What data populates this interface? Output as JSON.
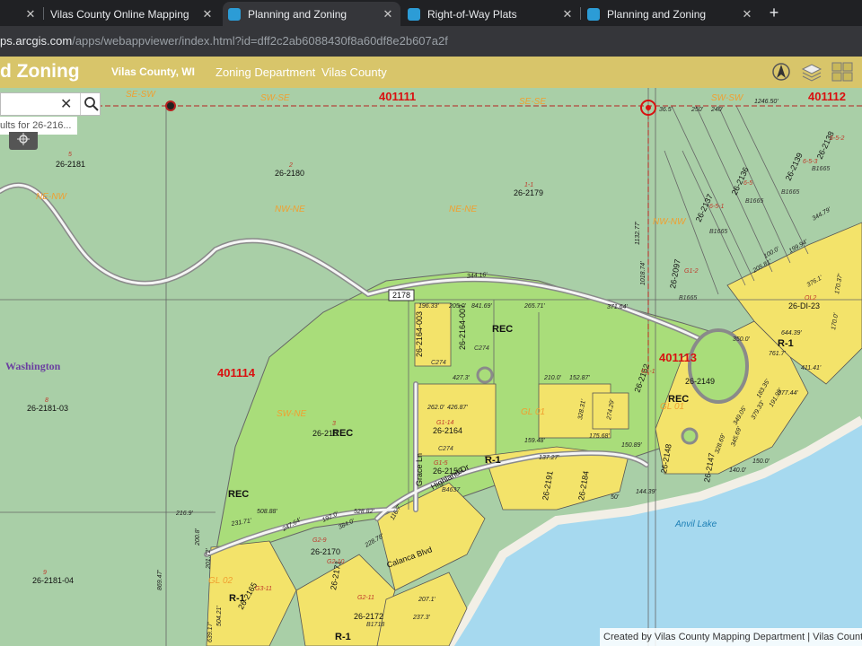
{
  "browser": {
    "tabs": [
      {
        "title": "Vilas County Online Mapping",
        "favicon": "map-icon"
      },
      {
        "title": "Planning and Zoning",
        "favicon": "esri-icon"
      },
      {
        "title": "Right-of-Way Plats",
        "favicon": "esri-icon"
      },
      {
        "title": "Planning and Zoning",
        "favicon": "esri-icon"
      }
    ],
    "close_glyph": "✕",
    "new_tab_glyph": "+",
    "url_host": "ps.arcgis.com",
    "url_rest": "/apps/webappviewer/index.html?id=dff2c2ab6088430f8a60df8e2b607a2f"
  },
  "app": {
    "title": "d Zoning",
    "org": "Vilas County, WI",
    "subtitle_dept": "Zoning Department",
    "subtitle_county": "Vilas County"
  },
  "search": {
    "clear_glyph": "✕",
    "suggestion": "ults for 26-216..."
  },
  "map": {
    "sections": [
      "401111",
      "401112",
      "401113",
      "401114"
    ],
    "quarters": [
      "SE-SW",
      "SW-SE",
      "SE-SE",
      "SW-SW",
      "NE-NW",
      "NW-NE",
      "NE-NE",
      "NW-NW",
      "SW-NE",
      "GL 01",
      "GL 01",
      "GL 02"
    ],
    "zones": [
      "REC",
      "REC",
      "REC",
      "REC",
      "R-1",
      "R-1",
      "R-1",
      "R-1"
    ],
    "township": "Washington",
    "lake": "Anvil Lake",
    "road_shield": "2178",
    "roads": [
      "Highland Dr",
      "Grace Ln",
      "Calanca Blvd"
    ],
    "parcels": [
      "26-2181",
      "26-2180",
      "26-2179",
      "26-2181-03",
      "26-2181-04",
      "26-2164-003",
      "26-2164-007",
      "26-2164",
      "26-2159",
      "26-2191",
      "26-2184",
      "26-2152",
      "26-2149",
      "26-2148",
      "26-2147",
      "26-2170",
      "26-2171",
      "26-2165",
      "26-2172",
      "26-2138",
      "26-2139",
      "26-2136",
      "26-2137",
      "26-2097",
      "26-DI-23",
      "26-216"
    ],
    "lot_labels": [
      "5",
      "2",
      "1-1",
      "8",
      "9",
      "3",
      "G1-14",
      "G1-5",
      "G1-1",
      "G2-9",
      "G2-10",
      "G2-11",
      "G3-11",
      "6-5-2",
      "6-5-3",
      "6-5",
      "6-5-1",
      "G1-2",
      "OL2",
      "C274",
      "C274",
      "C274",
      "B4637",
      "B1718",
      "B1665",
      "B1665",
      "B1665",
      "B1665",
      "B1665"
    ],
    "dimensions": [
      "1246.50'",
      "1132.77'",
      "1018.74'",
      "344.16'",
      "371.64'",
      "205.0'",
      "841.69'",
      "265.71'",
      "196.33'",
      "427.3'",
      "262.0'",
      "426.87'",
      "210.0'",
      "152.87'",
      "159.48'",
      "175.68'",
      "150.89'",
      "328.31'",
      "274.29'",
      "137.27'",
      "50'",
      "144.39'",
      "100.0'",
      "199.94'",
      "205.81'",
      "344.79'",
      "376.1'",
      "170.37'",
      "170.0'",
      "644.39'",
      "350.0'",
      "761.7'",
      "411.41'",
      "377.44'",
      "191.99'",
      "379.33'",
      "349.05'",
      "183.35'",
      "150.0'",
      "140.0'",
      "328.69'",
      "345.69'",
      "508.88'",
      "528.82'",
      "216.9'",
      "231.71'",
      "247.64'",
      "192.0'",
      "384.0'",
      "228.78'",
      "116.7'",
      "200.8'",
      "201.72'",
      "869.47'",
      "504.21'",
      "639.17'",
      "207.1'",
      "237.3'",
      "250'",
      "240'",
      "36.5'"
    ]
  },
  "attribution": "Created by Vilas County Mapping Department | Vilas County",
  "colors": {
    "map_bg": "#a9cfa7",
    "rec_zone": "#a9dd7a",
    "res_zone": "#f3e36a",
    "lake": "#a6d9ef",
    "road": "#b4b4b4",
    "section_label": "#d91111",
    "quarter_label": "#f0a030",
    "header_bg": "#d8c56a"
  }
}
